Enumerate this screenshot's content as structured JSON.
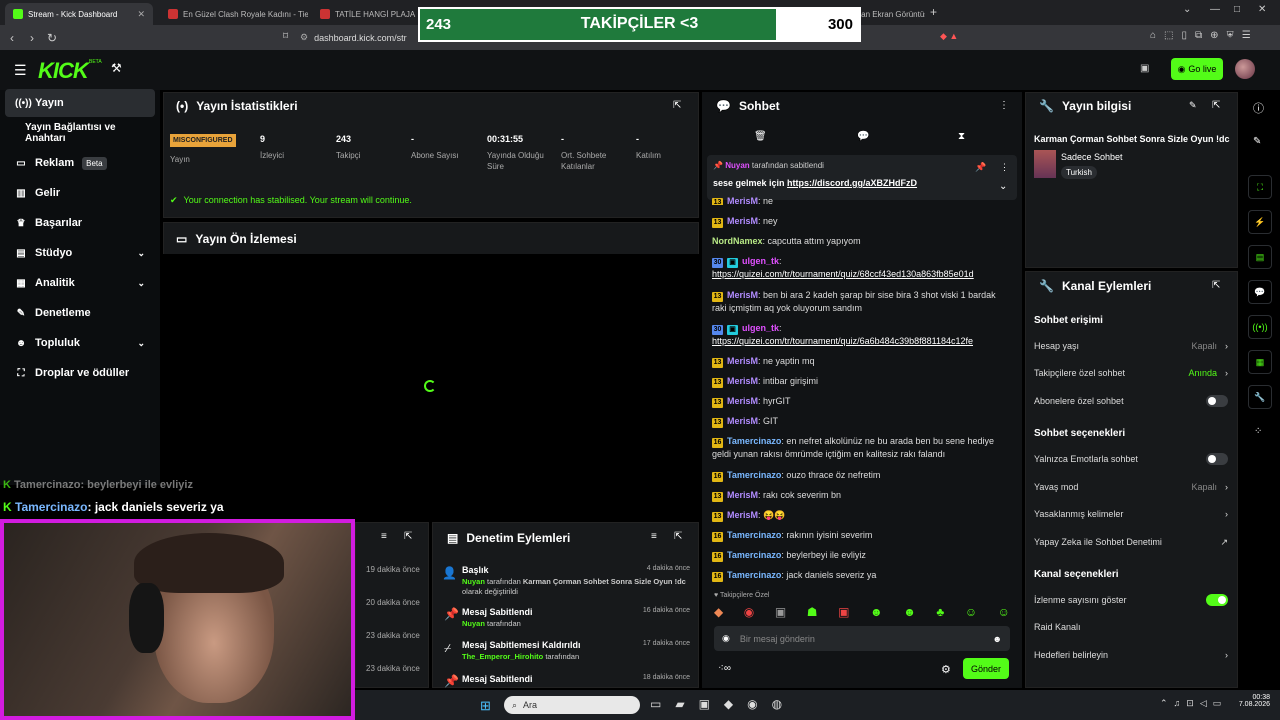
{
  "browser": {
    "tabs": [
      {
        "label": "Stream - Kick Dashboard",
        "active": true
      },
      {
        "label": "En Güzel Clash Royale Kadını - Tier Li..."
      },
      {
        "label": "TATİLE HANGİ PLAJA GEL..."
      },
      {
        "label": "LightShot tarafından Ekran Görüntüsü"
      }
    ],
    "url": "dashboard.kick.com/str"
  },
  "overlay": {
    "left": "243",
    "title": "TAKİPÇİLER <3",
    "right": "300",
    "progress": 0.81
  },
  "header": {
    "logo": "KICK",
    "beta": "BETA",
    "go_live": "Go live"
  },
  "sidebar": {
    "items": [
      {
        "label": "Yayın",
        "icon": "broadcast-icon"
      },
      {
        "label": "Yayın Bağlantısı ve Anahtarı"
      },
      {
        "label": "Reklam",
        "badge": "Beta",
        "icon": "monitor-icon"
      },
      {
        "label": "Gelir",
        "icon": "chart-icon"
      },
      {
        "label": "Başarılar",
        "icon": "trophy-icon"
      },
      {
        "label": "Stüdyo",
        "icon": "studio-icon"
      },
      {
        "label": "Analitik",
        "icon": "analytics-icon"
      },
      {
        "label": "Denetleme",
        "icon": "wrench-icon"
      },
      {
        "label": "Topluluk",
        "icon": "community-icon"
      },
      {
        "label": "Droplar ve ödüller",
        "icon": "drops-icon"
      }
    ]
  },
  "stats": {
    "title": "Yayın İstatistikleri",
    "status_badge": "MISCONFIGURED",
    "status_label": "Yayın",
    "cols": [
      {
        "value": "9",
        "label": "İzleyici"
      },
      {
        "value": "243",
        "label": "Takipçi"
      },
      {
        "value": "-",
        "label": "Abone Sayısı"
      },
      {
        "value": "00:31:55",
        "label": "Yayında Olduğu Süre"
      },
      {
        "value": "-",
        "label": "Ort. Sohbete Katılanlar"
      },
      {
        "value": "-",
        "label": "Katılım"
      }
    ],
    "notice": "Your connection has stabilised. Your stream will continue."
  },
  "preview": {
    "title": "Yayın Ön İzlemesi"
  },
  "overlay_chat": [
    {
      "user": "Tamercinazo",
      "text": ": beylerbeyi ile evliyiz"
    },
    {
      "user": "Tamercinazo",
      "text": ": jack daniels severiz ya"
    }
  ],
  "activity": {
    "times": [
      "19 dakika önce",
      "20 dakika önce",
      "23 dakika önce",
      "23 dakika önce"
    ]
  },
  "mod": {
    "title": "Denetim Eylemleri",
    "items": [
      {
        "title": "Başlık",
        "time": "4 dakika önce",
        "user": "Nuyan",
        "mid": " tarafından ",
        "bold": "Karman Çorman Sohbet Sonra Sizle Oyun !dc",
        "tail": " olarak değiştirildi"
      },
      {
        "title": "Mesaj Sabitlendi",
        "time": "16 dakika önce",
        "user": "Nuyan",
        "mid": " tarafından"
      },
      {
        "title": "Mesaj Sabitlemesi Kaldırıldı",
        "time": "17 dakika önce",
        "user": "The_Emperor_Hirohito",
        "mid": " tarafından"
      },
      {
        "title": "Mesaj Sabitlendi",
        "time": "18 dakika önce"
      }
    ]
  },
  "chat": {
    "title": "Sohbet",
    "pinned": {
      "by": "Nuyan",
      "by_suffix": " tarafından sabitlendi",
      "text": "sese gelmek için ",
      "link": "https://discord.gg/aXBZHdFzD"
    },
    "messages": [
      {
        "b": "13",
        "user": "MerisM",
        "color": "#b18cff",
        "text": "ne"
      },
      {
        "b": "13",
        "user": "MerisM",
        "color": "#b18cff",
        "text": "ney"
      },
      {
        "user": "NordNamex",
        "color": "#b8e986",
        "text": "capcutta attım yapıyom"
      },
      {
        "b": "30",
        "user": "ulgen_tk",
        "color": "#e050ff",
        "text": "",
        "link": "https://quizei.com/tr/tournament/quiz/68ccf43ed130a863fb85e01d"
      },
      {
        "b": "13",
        "user": "MerisM",
        "color": "#b18cff",
        "text": "ben bi ara 2 kadeh şarap bir sise bira 3 shot viski 1 bardak raki içmiştim aq yok oluyorum sandım"
      },
      {
        "b": "30",
        "user": "ulgen_tk",
        "color": "#e050ff",
        "text": "",
        "link": "https://quizei.com/tr/tournament/quiz/6a6b484c39b8f881184c12fe"
      },
      {
        "b": "13",
        "user": "MerisM",
        "color": "#b18cff",
        "text": "ne yaptin mq"
      },
      {
        "b": "13",
        "user": "MerisM",
        "color": "#b18cff",
        "text": "intibar girişimi"
      },
      {
        "b": "13",
        "user": "MerisM",
        "color": "#b18cff",
        "text": "hyrGIT"
      },
      {
        "b": "13",
        "user": "MerisM",
        "color": "#b18cff",
        "text": "GIT"
      },
      {
        "b": "16",
        "user": "Tamercinazo",
        "color": "#7ab8ff",
        "text": "en nefret alkolünüz ne bu arada ben bu sene hediye geldi yunan rakısı ömrümde içtiğim en kalitesiz rakı falandı"
      },
      {
        "b": "16",
        "user": "Tamercinazo",
        "color": "#7ab8ff",
        "text": "ouzo thrace öz nefretim"
      },
      {
        "b": "13",
        "user": "MerisM",
        "color": "#b18cff",
        "text": "rakı cok severim bn"
      },
      {
        "b": "13",
        "user": "MerisM",
        "color": "#b18cff",
        "text": "😝😝"
      },
      {
        "b": "16",
        "user": "Tamercinazo",
        "color": "#7ab8ff",
        "text": "rakının iyisini severim"
      },
      {
        "b": "16",
        "user": "Tamercinazo",
        "color": "#7ab8ff",
        "text": "beylerbeyi ile evliyiz"
      },
      {
        "b": "16",
        "user": "Tamercinazo",
        "color": "#7ab8ff",
        "text": "jack daniels severiz ya"
      }
    ],
    "emote_label": "Takipçilere Özel",
    "placeholder": "Bir mesaj gönderin",
    "send": "Gönder"
  },
  "info": {
    "title": "Yayın bilgisi",
    "stream_title": "Karman Çorman Sohbet Sonra Sizle Oyun !dc",
    "category": "Sadece Sohbet",
    "tag": "Turkish"
  },
  "channel": {
    "title": "Kanal Eylemleri",
    "s1": "Sohbet erişimi",
    "rows1": [
      {
        "label": "Hesap yaşı",
        "val": "Kapalı",
        "kind": "arrow"
      },
      {
        "label": "Takipçilere özel sohbet",
        "val": "Anında",
        "kind": "arrow",
        "green": true
      },
      {
        "label": "Abonelere özel sohbet",
        "kind": "toggle"
      }
    ],
    "s2": "Sohbet seçenekleri",
    "rows2": [
      {
        "label": "Yalnızca Emotlarla sohbet",
        "kind": "toggle"
      },
      {
        "label": "Yavaş mod",
        "val": "Kapalı",
        "kind": "arrow"
      },
      {
        "label": "Yasaklanmış kelimeler",
        "kind": "arrow"
      },
      {
        "label": "Yapay Zeka ile Sohbet Denetimi",
        "kind": "ext"
      }
    ],
    "s3": "Kanal seçenekleri",
    "rows3": [
      {
        "label": "İzlenme sayısını göster",
        "kind": "toggle",
        "on": true
      },
      {
        "label": "Raid Kanalı",
        "kind": "none"
      },
      {
        "label": "Hedefleri belirleyin",
        "kind": "arrow"
      }
    ]
  },
  "taskbar": {
    "search": "Ara",
    "time": "00:38",
    "date": "7.08.2026"
  }
}
